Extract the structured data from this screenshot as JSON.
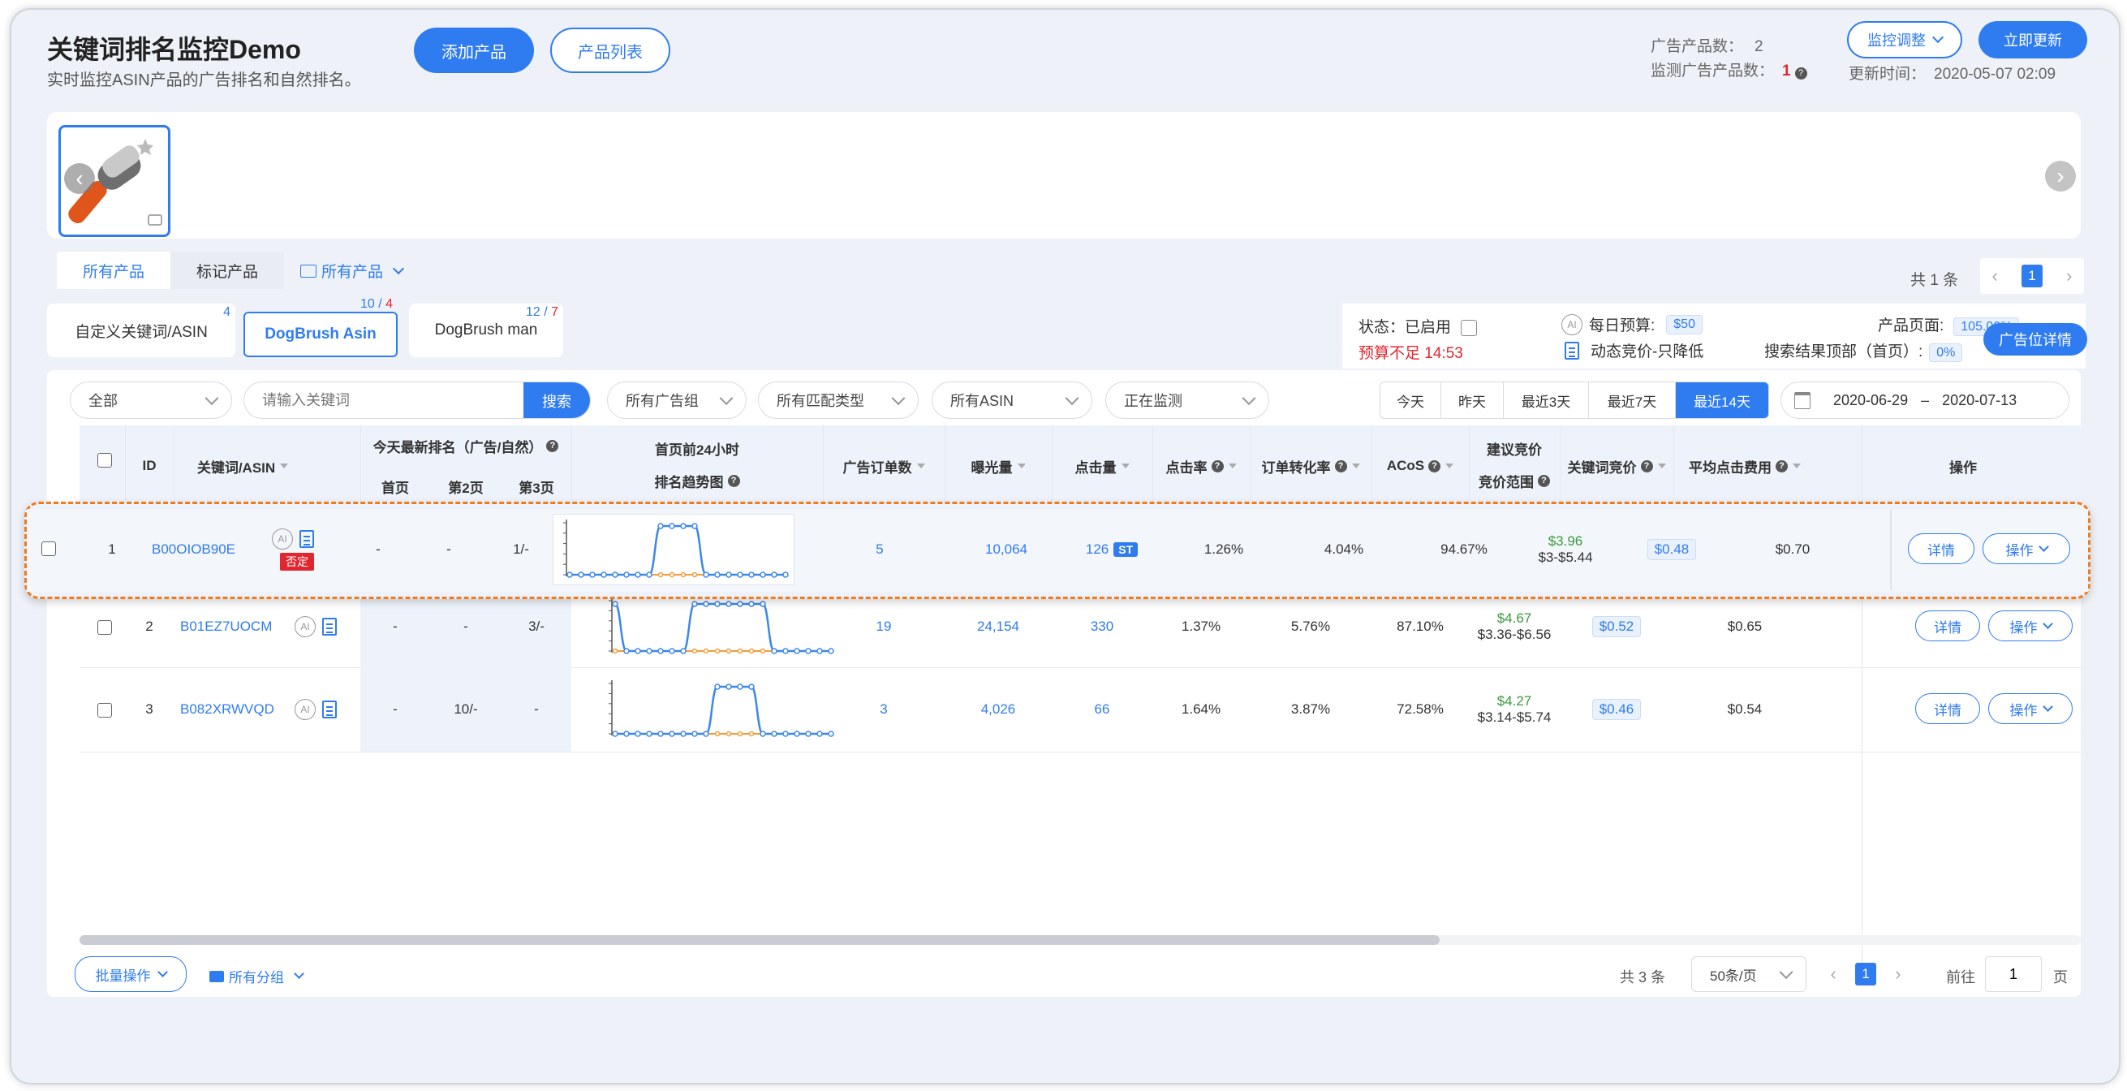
{
  "header": {
    "title": "关键词排名监控Demo",
    "subtitle": "实时监控ASIN产品的广告排名和自然排名。",
    "add_product": "添加产品",
    "product_list": "产品列表",
    "ad_product_count_label": "广告产品数：",
    "ad_product_count": "2",
    "monitor_ad_count_label": "监测广告产品数：",
    "monitor_ad_count": "1",
    "monitor_adjust": "监控调整",
    "update_now": "立即更新",
    "update_time_label": "更新时间：",
    "update_time": "2020-05-07 02:09"
  },
  "filters_top": {
    "tab_all": "所有产品",
    "tab_marked": "标记产品",
    "folder_all": "所有产品",
    "total": "共 1 条",
    "page": "1"
  },
  "keyword_tabs": [
    {
      "label": "自定义关键词/ASIN",
      "count": "4",
      "count_red": ""
    },
    {
      "label": "DogBrush Asin",
      "count": "10 / ",
      "count_red": "4"
    },
    {
      "label": "DogBrush man",
      "count": "12 / ",
      "count_red": "7"
    }
  ],
  "status": {
    "state_label": "状态：已启用",
    "budget_low": "预算不足 14:53",
    "daily_budget_label": "每日预算:",
    "daily_budget": "$50",
    "dynamic_bid": "动态竞价-只降低",
    "product_page_label": "产品页面:",
    "product_page": "105.00%",
    "search_top_label": "搜索结果顶部（首页）:",
    "search_top": "0%",
    "ad_detail_btn": "广告位详情",
    "ai_icon": "AI"
  },
  "toolbar": {
    "all": "全部",
    "search_placeholder": "请输入关键词",
    "search_btn": "搜索",
    "ad_group": "所有广告组",
    "match_type": "所有匹配类型",
    "asin": "所有ASIN",
    "monitoring": "正在监测",
    "ranges": [
      "今天",
      "昨天",
      "最近3天",
      "最近7天",
      "最近14天"
    ],
    "date_from": "2020-06-29",
    "date_sep": "–",
    "date_to": "2020-07-13"
  },
  "table": {
    "headers": {
      "id": "ID",
      "keyword": "关键词/ASIN",
      "today_rank": "今天最新排名（广告/自然）",
      "page1": "首页",
      "page2": "第2页",
      "page3": "第3页",
      "trend1": "首页前24小时",
      "trend2": "排名趋势图",
      "orders": "广告订单数",
      "impressions": "曝光量",
      "clicks": "点击量",
      "ctr": "点击率",
      "cvr": "订单转化率",
      "acos": "ACoS",
      "suggest1": "建议竞价",
      "suggest2": "竞价范围",
      "kw_bid": "关键词竞价",
      "cpc": "平均点击费用",
      "ops": "操作"
    },
    "rows": [
      {
        "id": "1",
        "asin": "B00OIOB90E",
        "tag": "否定",
        "p1": "-",
        "p2": "-",
        "p3": "1/-",
        "orders": "5",
        "impressions": "10,064",
        "clicks": "126",
        "st": "ST",
        "ctr": "1.26%",
        "cvr": "4.04%",
        "acos": "94.67%",
        "suggest": "$3.96",
        "range": "$3-$5.44",
        "bid": "$0.48",
        "cpc": "$0.70",
        "trend": [
          0,
          0,
          0,
          0,
          0,
          0,
          0,
          0,
          1,
          1,
          1,
          1,
          0,
          0,
          0,
          0,
          0,
          0,
          0,
          0
        ],
        "trend2": [
          0,
          0,
          0,
          0,
          0,
          0,
          0,
          0,
          0,
          0,
          0,
          0,
          0,
          0,
          0,
          0,
          0,
          0,
          0,
          0
        ]
      },
      {
        "id": "2",
        "asin": "B01EZ7UOCM",
        "tag": "",
        "p1": "-",
        "p2": "-",
        "p3": "3/-",
        "orders": "19",
        "impressions": "24,154",
        "clicks": "330",
        "st": "",
        "ctr": "1.37%",
        "cvr": "5.76%",
        "acos": "87.10%",
        "suggest": "$4.67",
        "range": "$3.36-$6.56",
        "bid": "$0.52",
        "cpc": "$0.65",
        "trend": [
          1,
          0,
          0,
          0,
          0,
          0,
          0,
          1,
          1,
          1,
          1,
          1,
          1,
          1,
          0,
          0,
          0,
          0,
          0,
          0
        ],
        "trend2": [
          0,
          0,
          0,
          0,
          0,
          0,
          0,
          0,
          0,
          0,
          0,
          0,
          0,
          0,
          0,
          0,
          0,
          0,
          0,
          0
        ]
      },
      {
        "id": "3",
        "asin": "B082XRWVQD",
        "tag": "",
        "p1": "-",
        "p2": "10/-",
        "p3": "-",
        "orders": "3",
        "impressions": "4,026",
        "clicks": "66",
        "st": "",
        "ctr": "1.64%",
        "cvr": "3.87%",
        "acos": "72.58%",
        "suggest": "$4.27",
        "range": "$3.14-$5.74",
        "bid": "$0.46",
        "cpc": "$0.54",
        "trend": [
          0,
          0,
          0,
          0,
          0,
          0,
          0,
          0,
          0,
          1,
          1,
          1,
          1,
          0,
          0,
          0,
          0,
          0,
          0,
          0
        ],
        "trend2": [
          0,
          0,
          0,
          0,
          0,
          0,
          0,
          0,
          0,
          0,
          0,
          0,
          0,
          0,
          0,
          0,
          0,
          0,
          0,
          0
        ]
      }
    ],
    "detail_btn": "详情",
    "op_btn": "操作"
  },
  "footer": {
    "batch": "批量操作",
    "group": "所有分组",
    "total": "共 3 条",
    "per_page": "50条/页",
    "page": "1",
    "goto": "前往",
    "goto_value": "1",
    "page_unit": "页"
  },
  "colors": {
    "accent": "#2f7cf0",
    "highlight": "#f07a1c",
    "danger": "#e0272f"
  }
}
